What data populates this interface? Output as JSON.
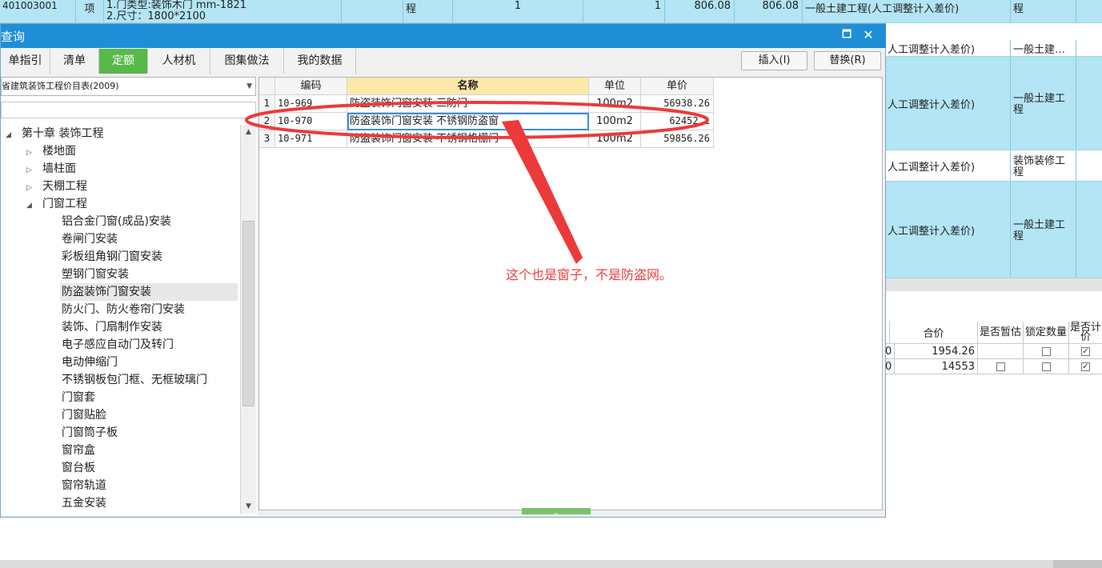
{
  "background_sheet": {
    "top_row": {
      "code": "401003001",
      "unit": "项",
      "desc_line1": "1.门类型:装饰木门 mm-1821",
      "desc_line2": "2.尺寸：1800*2100",
      "cat": "程",
      "qty1": "1",
      "qty2": "1",
      "price1": "806.08",
      "price2": "806.08",
      "note": "一般土建工程(人工调整计入差价)",
      "type": "程"
    },
    "rows": [
      {
        "note": "人工调整计入差价)",
        "type": "一般土建…"
      },
      {
        "note": "人工调整计入差价)",
        "type": "一般土建工程"
      },
      {
        "note": "人工调整计入差价)",
        "type": "装饰装修工程"
      },
      {
        "note": "人工调整计入差价)",
        "type": "一般土建工程"
      }
    ]
  },
  "right_table": {
    "headers": [
      "合价",
      "是否暂估",
      "锁定数量",
      "是否计价"
    ],
    "rows": [
      {
        "prefix": "0",
        "total": "1954.26",
        "est": false,
        "lock": false,
        "priced": true
      },
      {
        "prefix": "0",
        "total": "14553",
        "est": false,
        "lock": false,
        "priced": true
      }
    ]
  },
  "dialog": {
    "title": "查询",
    "tabs": [
      "单指引",
      "清单",
      "定额",
      "人材机",
      "图集做法",
      "我的数据"
    ],
    "active_tab": "定额",
    "buttons": {
      "insert": "插入(I)",
      "replace": "替换(R)"
    },
    "combo_value": "省建筑装饰工程价目表(2009)",
    "tree": {
      "root": "第十章 装饰工程",
      "items": [
        {
          "label": "楼地面",
          "level": 1,
          "expandable": true
        },
        {
          "label": "墙柱面",
          "level": 1,
          "expandable": true
        },
        {
          "label": "天棚工程",
          "level": 1,
          "expandable": true
        },
        {
          "label": "门窗工程",
          "level": 1,
          "expanded": true
        },
        {
          "label": "铝合金门窗(成品)安装",
          "level": 2
        },
        {
          "label": "卷闸门安装",
          "level": 2
        },
        {
          "label": "彩板组角钢门窗安装",
          "level": 2
        },
        {
          "label": "塑钢门窗安装",
          "level": 2
        },
        {
          "label": "防盗装饰门窗安装",
          "level": 2,
          "selected": true
        },
        {
          "label": "防火门、防火卷帘门安装",
          "level": 2
        },
        {
          "label": "装饰、门扇制作安装",
          "level": 2
        },
        {
          "label": "电子感应自动门及转门",
          "level": 2
        },
        {
          "label": "电动伸缩门",
          "level": 2
        },
        {
          "label": "不锈钢板包门框、无框玻璃门",
          "level": 2
        },
        {
          "label": "门窗套",
          "level": 2
        },
        {
          "label": "门窗贴脸",
          "level": 2
        },
        {
          "label": "门窗筒子板",
          "level": 2
        },
        {
          "label": "窗帘盒",
          "level": 2
        },
        {
          "label": "窗台板",
          "level": 2
        },
        {
          "label": "窗帘轨道",
          "level": 2
        },
        {
          "label": "五金安装",
          "level": 2
        }
      ]
    },
    "grid": {
      "headers": {
        "code": "编码",
        "name": "名称",
        "unit": "单位",
        "price": "单价"
      },
      "rows": [
        {
          "idx": "1",
          "code": "10-969",
          "name": "防盗装饰门窗安装 三防门",
          "unit": "100m2",
          "price": "56938.26"
        },
        {
          "idx": "2",
          "code": "10-970",
          "name": "防盗装饰门窗安装 不锈钢防盗窗",
          "unit": "100m2",
          "price": "62452.1"
        },
        {
          "idx": "3",
          "code": "10-971",
          "name": "防盗装饰门窗安装 不锈钢格栅门",
          "unit": "100m2",
          "price": "59856.26"
        }
      ]
    }
  },
  "annotation": {
    "text": "这个也是窗子，不是防盗网。",
    "color": "#e8413e"
  }
}
